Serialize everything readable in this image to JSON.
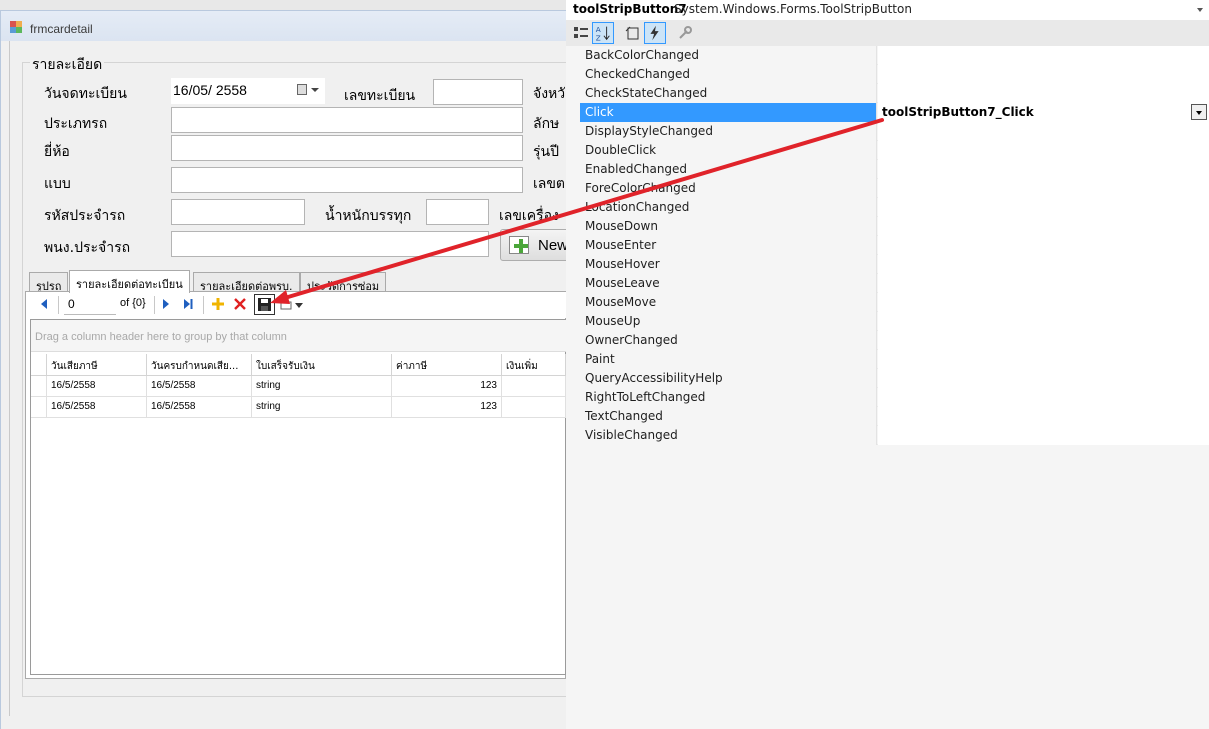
{
  "form": {
    "title": "frmcardetail",
    "group_title": "รายละเอียด",
    "labels": {
      "reg_date": "วันจดทะเบียน",
      "reg_no": "เลขทะเบียน",
      "province": "จังหวั",
      "car_type": "ประเภทรถ",
      "feature": "ลักษ",
      "brand": "ยี่ห้อ",
      "model_year": "รุ่นปี",
      "model": "แบบ",
      "chassis_no": "เลขต",
      "car_code": "รหัสประจำรถ",
      "weight": "น้ำหนักบรรทุก",
      "engine_no": "เลขเครื่อง",
      "officer": "พนง.ประจำรถ"
    },
    "reg_date_value": "16/05/  2558",
    "new_button": "New",
    "tabs": [
      "รูปรถ",
      "รายละเอียดต่อทะเบียน",
      "รายละเอียดต่อพรบ.",
      "ประวัติการซ่อม"
    ],
    "active_tab": "รายละเอียดต่อทะเบียน",
    "navigator": {
      "position": "0",
      "of_text": "of {0}"
    },
    "grid": {
      "group_panel_text": "Drag a column header here to group by that column",
      "columns": [
        "วันเสียภาษี",
        "วันครบกำหนดเสีย...",
        "ใบเสร็จรับเงิน",
        "ค่าภาษี",
        "เงินเพิ่ม"
      ],
      "rows": [
        [
          "16/5/2558",
          "16/5/2558",
          "string",
          "123",
          ""
        ],
        [
          "16/5/2558",
          "16/5/2558",
          "string",
          "123",
          ""
        ]
      ]
    }
  },
  "properties": {
    "object_name": "toolStripButton7",
    "object_type": "System.Windows.Forms.ToolStripButton",
    "toolbar_icons": [
      "categorized-icon",
      "alphabetical-icon",
      "properties-icon",
      "events-icon",
      "property-pages-icon"
    ],
    "events": [
      {
        "name": "BackColorChanged",
        "value": ""
      },
      {
        "name": "CheckedChanged",
        "value": ""
      },
      {
        "name": "CheckStateChanged",
        "value": ""
      },
      {
        "name": "Click",
        "value": "toolStripButton7_Click"
      },
      {
        "name": "DisplayStyleChanged",
        "value": ""
      },
      {
        "name": "DoubleClick",
        "value": ""
      },
      {
        "name": "EnabledChanged",
        "value": ""
      },
      {
        "name": "ForeColorChanged",
        "value": ""
      },
      {
        "name": "LocationChanged",
        "value": ""
      },
      {
        "name": "MouseDown",
        "value": ""
      },
      {
        "name": "MouseEnter",
        "value": ""
      },
      {
        "name": "MouseHover",
        "value": ""
      },
      {
        "name": "MouseLeave",
        "value": ""
      },
      {
        "name": "MouseMove",
        "value": ""
      },
      {
        "name": "MouseUp",
        "value": ""
      },
      {
        "name": "OwnerChanged",
        "value": ""
      },
      {
        "name": "Paint",
        "value": ""
      },
      {
        "name": "QueryAccessibilityHelp",
        "value": ""
      },
      {
        "name": "RightToLeftChanged",
        "value": ""
      },
      {
        "name": "TextChanged",
        "value": ""
      },
      {
        "name": "VisibleChanged",
        "value": ""
      }
    ],
    "selected_event": "Click"
  },
  "colors": {
    "selection": "#3399ff",
    "annotation_arrow": "#e0232a",
    "add_icon": "#f0b400",
    "delete_icon": "#e02020",
    "nav_icon": "#1f5fbf"
  }
}
